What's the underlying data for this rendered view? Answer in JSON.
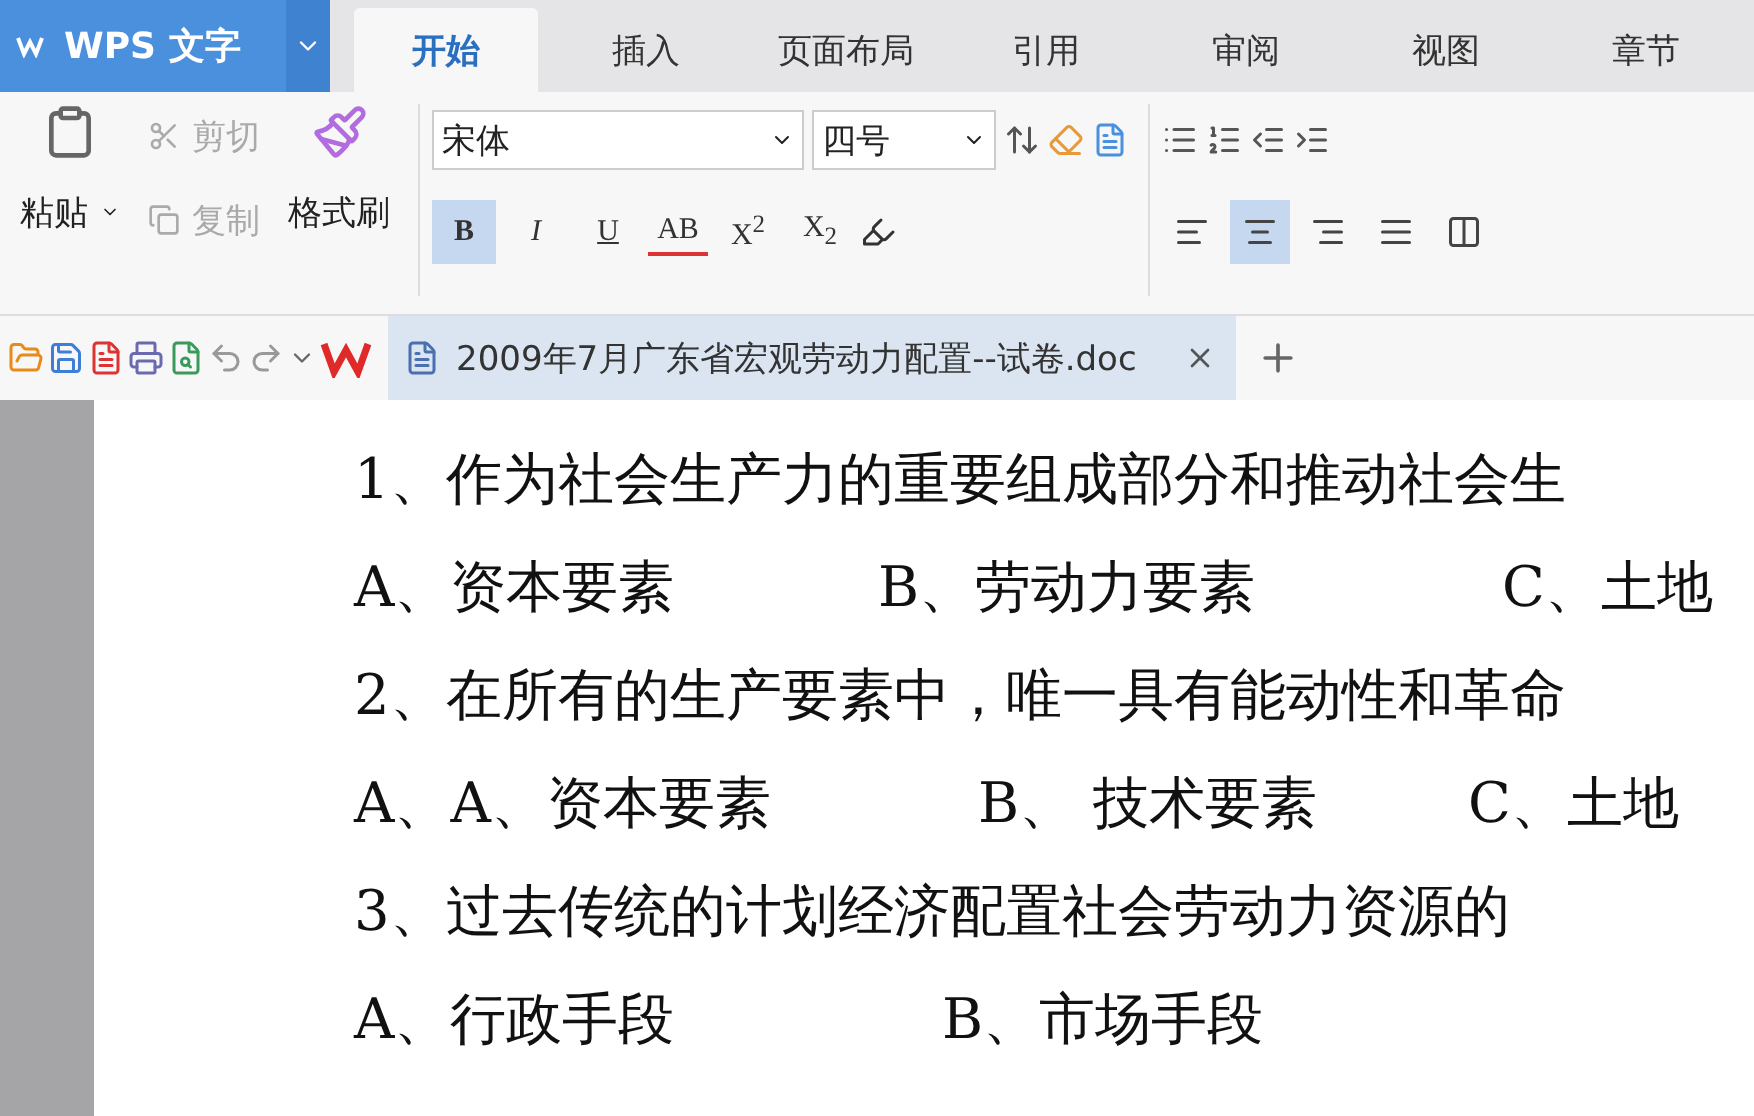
{
  "app_menu": {
    "label": "WPS 文字"
  },
  "tabs": [
    {
      "label": "开始",
      "selected": true
    },
    {
      "label": "插入",
      "selected": false
    },
    {
      "label": "页面布局",
      "selected": false
    },
    {
      "label": "引用",
      "selected": false
    },
    {
      "label": "审阅",
      "selected": false
    },
    {
      "label": "视图",
      "selected": false
    },
    {
      "label": "章节",
      "selected": false
    }
  ],
  "clipboard": {
    "paste": "粘贴",
    "cut": {
      "label": "剪切",
      "disabled": true
    },
    "copy": {
      "label": "复制",
      "disabled": true
    },
    "format_painter": "格式刷"
  },
  "font": {
    "name": "宋体",
    "size": "四号"
  },
  "format_buttons": [
    {
      "label": "B",
      "kind": "bold",
      "selected": true
    },
    {
      "label": "I",
      "kind": "italic",
      "selected": false
    },
    {
      "label": "U",
      "kind": "underline",
      "selected": false
    },
    {
      "label": "AB",
      "kind": "strike",
      "selected": false
    },
    {
      "label": "X$^{2}$",
      "kind": "plain",
      "selected": false
    },
    {
      "label": "X$_{2}$",
      "kind": "plain",
      "selected": false
    }
  ],
  "align_buttons": [
    {
      "kind": "left",
      "selected": false
    },
    {
      "kind": "center",
      "selected": true
    },
    {
      "kind": "right",
      "selected": false
    },
    {
      "kind": "justify",
      "selected": false
    },
    {
      "kind": "distributed",
      "selected": false
    }
  ],
  "document_tab": {
    "title": "2009年7月广东省宏观劳动力配置--试卷.doc"
  },
  "document": {
    "lines": [
      {
        "segments": [
          "1、作为社会生产力的重要组成部分和推动社会生"
        ]
      },
      {
        "segments": [
          "A、资本要素",
          "B、劳动力要素",
          "C、土地"
        ]
      },
      {
        "segments": [
          "2、在所有的生产要素中，唯一具有能动性和革命"
        ]
      },
      {
        "segments": [
          "A、A、资本要素",
          "B、 技术要素",
          "C、土地"
        ]
      },
      {
        "segments": [
          "3、过去传统的计划经济配置社会劳动力资源的"
        ]
      },
      {
        "segments": [
          "A、行政手段",
          "B、市场手段"
        ]
      }
    ]
  }
}
